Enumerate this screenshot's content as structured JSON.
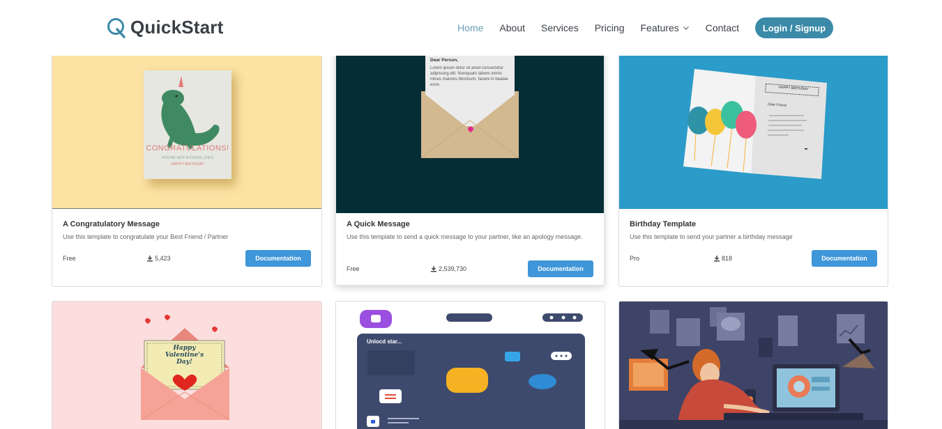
{
  "brand": {
    "name": "QuickStart",
    "color": "#3b8aa8"
  },
  "nav": {
    "items": [
      {
        "label": "Home",
        "active": true
      },
      {
        "label": "About"
      },
      {
        "label": "Services"
      },
      {
        "label": "Pricing"
      },
      {
        "label": "Features",
        "has_dropdown": true
      },
      {
        "label": "Contact"
      }
    ],
    "login_label": "Login / Signup"
  },
  "cards": [
    {
      "title": "A Congratulatory Message",
      "description": "Use this template to congratulate your Best Friend / Partner",
      "tier": "Free",
      "downloads": "5,423",
      "button": "Documentation",
      "image": {
        "bg": "#fce3a4",
        "card_text": "CONGRATULATIONS!",
        "card_subtext_1": "YOU'RE NOT A FOSSIL (YET)",
        "card_subtext_2": "HAPPY BIRTHDAY"
      }
    },
    {
      "title": "A Quick Message",
      "description": "Use this template to send a quick message to your partner, like an apology message.",
      "tier": "Free",
      "downloads": "2,539,730",
      "button": "Documentation",
      "image": {
        "bg": "#052d35",
        "letter_greeting": "Dear Person,",
        "letter_body": "Lorem ipsum dolor sit amet consectetur adipiscing elit. Numquam labore omnis minus maiores bborisum, facere in beatae esse."
      }
    },
    {
      "title": "Birthday Template",
      "description": "Use this template to send your partner a birthday message",
      "tier": "Pro",
      "downloads": "818",
      "button": "Documentation",
      "image": {
        "bg": "#2b9bc9",
        "card_text": "HAPPY BIRTHDAY",
        "card_greeting": "Dear Friend,"
      }
    },
    {
      "image": {
        "bg": "#fbdedd",
        "card_text_1": "Happy",
        "card_text_2": "Valentine's",
        "card_text_3": "Day!"
      }
    },
    {
      "image": {
        "bg": "#ffffff",
        "panel_text": "Unlocd star..."
      }
    },
    {
      "image": {
        "bg": "#3e4467"
      }
    }
  ]
}
